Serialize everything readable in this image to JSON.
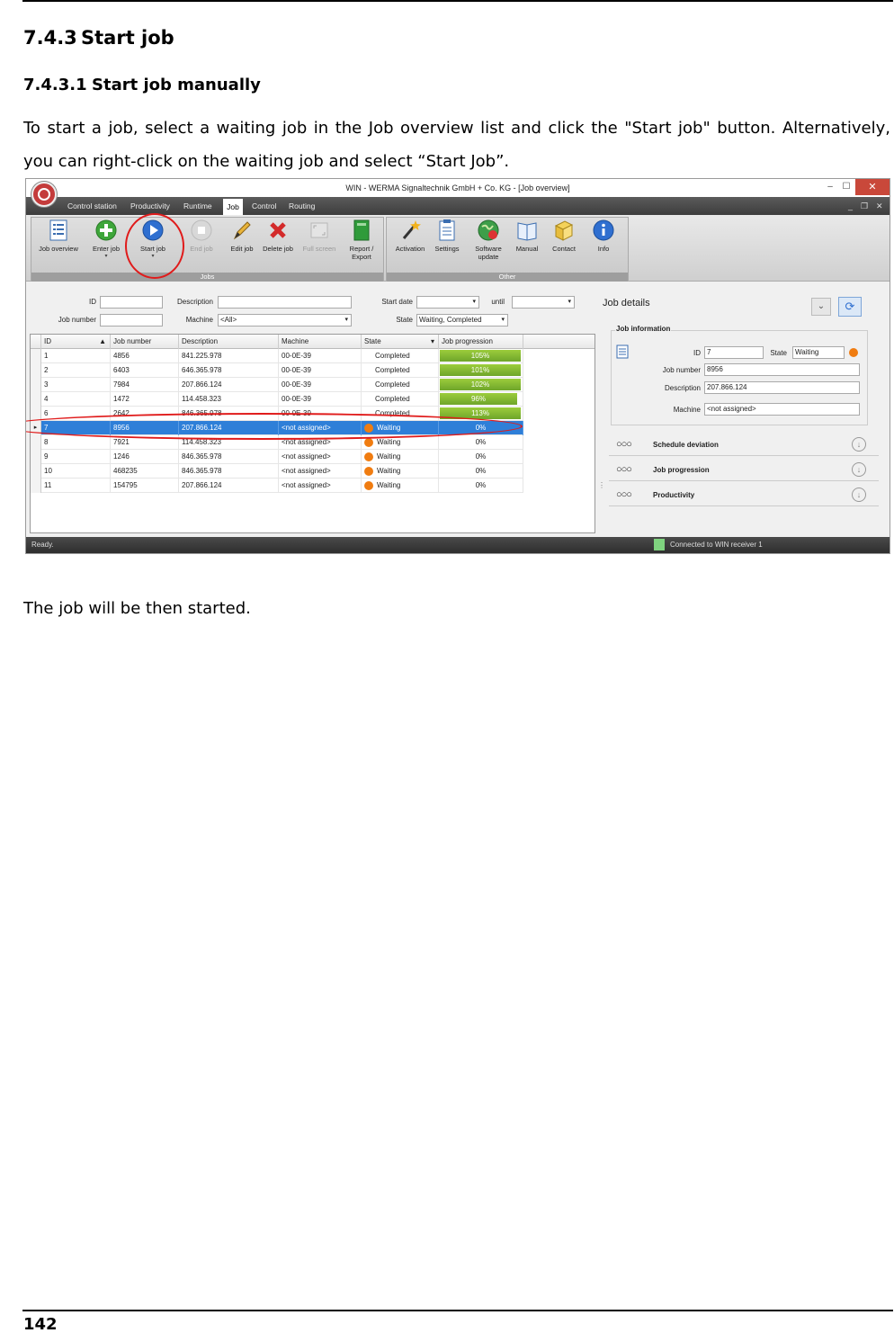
{
  "heading_2": {
    "number": "7.4.3",
    "title": "Start job"
  },
  "heading_3": {
    "number": "7.4.3.1",
    "title": "Start job manually"
  },
  "paragraph_1": "To start a job, select a waiting job in the Job overview list and click the \"Start job\" button. Alternatively, you can right-click on the waiting job and select “Start Job”.",
  "paragraph_2": "The job will be then started.",
  "page_number": "142",
  "screenshot": {
    "window_title": "WIN - WERMA Signaltechnik GmbH + Co. KG - [Job overview]",
    "window_controls": {
      "minimize": "–",
      "maximize": "☐",
      "close": "✕"
    },
    "mdi_controls": {
      "minimize": "_",
      "restore": "❐",
      "close": "✕"
    },
    "menu": [
      "Control station",
      "Productivity",
      "Runtime",
      "Job",
      "Control",
      "Routing"
    ],
    "ribbon": {
      "jobs_group_label": "Jobs",
      "other_group_label": "Other",
      "buttons": {
        "job_overview": "Job overview",
        "enter_job": "Enter job",
        "start_job": "Start job",
        "end_job": "End job",
        "edit_job": "Edit job",
        "delete_job": "Delete job",
        "full_screen": "Full screen",
        "report_export": "Report / Export",
        "activation": "Activation",
        "settings": "Settings",
        "software_update": "Software update",
        "manual": "Manual",
        "contact": "Contact",
        "info": "Info"
      }
    },
    "filters": {
      "id_label": "ID",
      "description_label": "Description",
      "start_date_label": "Start date",
      "until_label": "until",
      "job_number_label": "Job number",
      "machine_label": "Machine",
      "machine_value": "<All>",
      "state_label": "State",
      "state_value": "Waiting, Completed"
    },
    "grid": {
      "columns": [
        "ID",
        "Job number",
        "Description",
        "Machine",
        "State",
        "Job progression"
      ],
      "rows": [
        {
          "id": "1",
          "job_number": "4856",
          "description": "841.225.978",
          "machine": "00-0E-39",
          "state": "Completed",
          "progress": "105%",
          "progress_value": 105
        },
        {
          "id": "2",
          "job_number": "6403",
          "description": "646.365.978",
          "machine": "00-0E-39",
          "state": "Completed",
          "progress": "101%",
          "progress_value": 101
        },
        {
          "id": "3",
          "job_number": "7984",
          "description": "207.866.124",
          "machine": "00-0E-39",
          "state": "Completed",
          "progress": "102%",
          "progress_value": 102
        },
        {
          "id": "4",
          "job_number": "1472",
          "description": "114.458.323",
          "machine": "00-0E-39",
          "state": "Completed",
          "progress": "96%",
          "progress_value": 96
        },
        {
          "id": "6",
          "job_number": "2642",
          "description": "846.365.978",
          "machine": "00-0E-39",
          "state": "Completed",
          "progress": "113%",
          "progress_value": 113
        },
        {
          "id": "7",
          "job_number": "8956",
          "description": "207.866.124",
          "machine": "<not assigned>",
          "state": "Waiting",
          "progress": "0%",
          "progress_value": 0
        },
        {
          "id": "8",
          "job_number": "7921",
          "description": "114.458.323",
          "machine": "<not assigned>",
          "state": "Waiting",
          "progress": "0%",
          "progress_value": 0
        },
        {
          "id": "9",
          "job_number": "1246",
          "description": "846.365.978",
          "machine": "<not assigned>",
          "state": "Waiting",
          "progress": "0%",
          "progress_value": 0
        },
        {
          "id": "10",
          "job_number": "468235",
          "description": "846.365.978",
          "machine": "<not assigned>",
          "state": "Waiting",
          "progress": "0%",
          "progress_value": 0
        },
        {
          "id": "11",
          "job_number": "154795",
          "description": "207.866.124",
          "machine": "<not assigned>",
          "state": "Waiting",
          "progress": "0%",
          "progress_value": 0
        }
      ],
      "selected_row": "7"
    },
    "job_details": {
      "title": "Job details",
      "section_title": "Job information",
      "id_label": "ID",
      "id_value": "7",
      "state_label": "State",
      "state_value": "Waiting",
      "job_number_label": "Job number",
      "job_number_value": "8956",
      "description_label": "Description",
      "description_value": "207.866.124",
      "machine_label": "Machine",
      "machine_value": "<not assigned>",
      "expanders": [
        "Schedule deviation",
        "Job progression",
        "Productivity"
      ]
    },
    "status": {
      "left": "Ready.",
      "right": "Connected to WIN receiver 1"
    },
    "colors": {
      "accent": "#2e7fd8",
      "waiting": "#f07c10",
      "progress": "#7db52f",
      "highlight": "#e01b1b"
    }
  }
}
